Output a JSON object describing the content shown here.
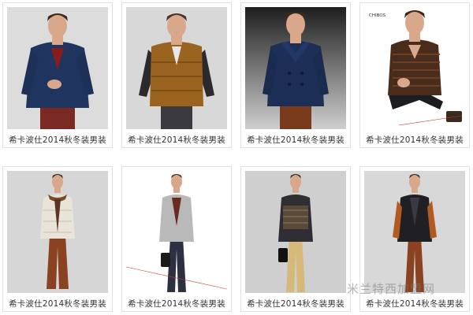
{
  "products": [
    {
      "caption": "希卡波仕2014秋冬装男装",
      "garment": "navy-wool-blazer"
    },
    {
      "caption": "希卡波仕2014秋冬装男装",
      "garment": "camel-puffer-vest"
    },
    {
      "caption": "希卡波仕2014秋冬装男装",
      "garment": "navy-peacoat"
    },
    {
      "caption": "希卡波仕2014秋冬装男装",
      "garment": "brown-striped-sweater",
      "brand_mark": "CHIBOS"
    },
    {
      "caption": "希卡波仕2014秋冬装男装",
      "garment": "cream-quilted-jacket"
    },
    {
      "caption": "希卡波仕2014秋冬装男装",
      "garment": "grey-tweed-blazer"
    },
    {
      "caption": "希卡波仕2014秋冬装男装",
      "garment": "patterned-knit-cardigan"
    },
    {
      "caption": "希卡波仕2014秋冬装男装",
      "garment": "black-orange-knit-vest"
    }
  ],
  "watermark": "米兰特西加盟网",
  "colors": {
    "border": "#e1e1e1",
    "caption_text": "#333333",
    "photo_bg_light": "#d9d9d9",
    "photo_bg_dark": "#2b2b2b"
  }
}
